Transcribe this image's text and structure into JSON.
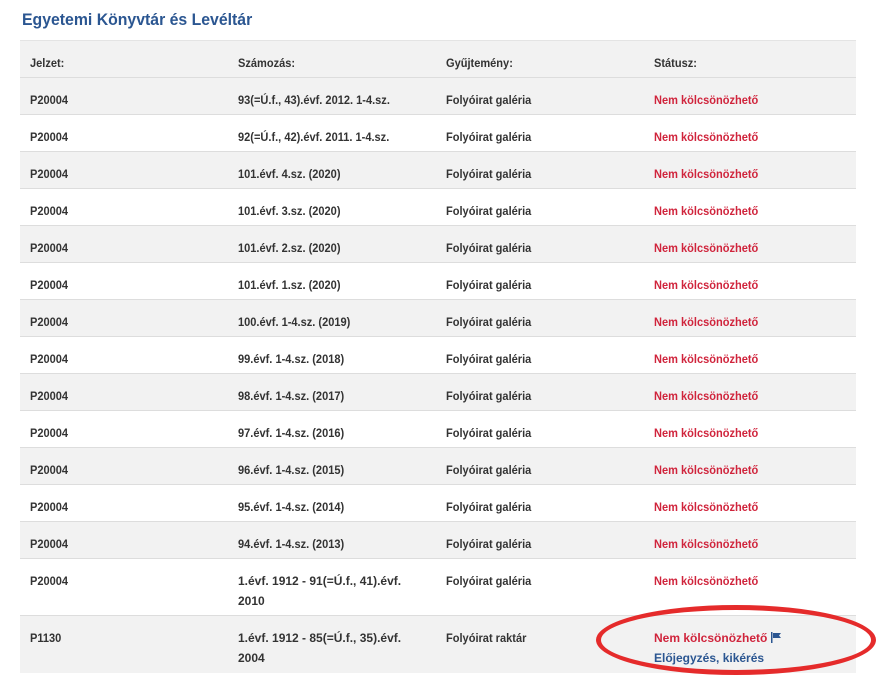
{
  "page": {
    "title": "Egyetemi Könyvtár és Levéltár"
  },
  "table": {
    "headers": [
      "Jelzet:",
      "Számozás:",
      "Gyűjtemény:",
      "Státusz:"
    ],
    "rows": [
      {
        "jelzet": "P20004",
        "szamozas": "93(=Ú.f., 43).évf. 2012. 1-4.sz.",
        "gyujtemeny": "Folyóirat galéria",
        "statusz": "Nem kölcsönözhető"
      },
      {
        "jelzet": "P20004",
        "szamozas": "92(=Ú.f., 42).évf. 2011. 1-4.sz.",
        "gyujtemeny": "Folyóirat galéria",
        "statusz": "Nem kölcsönözhető"
      },
      {
        "jelzet": "P20004",
        "szamozas": "101.évf. 4.sz. (2020)",
        "gyujtemeny": "Folyóirat galéria",
        "statusz": "Nem kölcsönözhető"
      },
      {
        "jelzet": "P20004",
        "szamozas": "101.évf. 3.sz. (2020)",
        "gyujtemeny": "Folyóirat galéria",
        "statusz": "Nem kölcsönözhető"
      },
      {
        "jelzet": "P20004",
        "szamozas": "101.évf. 2.sz. (2020)",
        "gyujtemeny": "Folyóirat galéria",
        "statusz": "Nem kölcsönözhető"
      },
      {
        "jelzet": "P20004",
        "szamozas": "101.évf. 1.sz. (2020)",
        "gyujtemeny": "Folyóirat galéria",
        "statusz": "Nem kölcsönözhető"
      },
      {
        "jelzet": "P20004",
        "szamozas": "100.évf. 1-4.sz. (2019)",
        "gyujtemeny": "Folyóirat galéria",
        "statusz": "Nem kölcsönözhető"
      },
      {
        "jelzet": "P20004",
        "szamozas": "99.évf. 1-4.sz. (2018)",
        "gyujtemeny": "Folyóirat galéria",
        "statusz": "Nem kölcsönözhető"
      },
      {
        "jelzet": "P20004",
        "szamozas": "98.évf. 1-4.sz. (2017)",
        "gyujtemeny": "Folyóirat galéria",
        "statusz": "Nem kölcsönözhető"
      },
      {
        "jelzet": "P20004",
        "szamozas": "97.évf. 1-4.sz. (2016)",
        "gyujtemeny": "Folyóirat galéria",
        "statusz": "Nem kölcsönözhető"
      },
      {
        "jelzet": "P20004",
        "szamozas": "96.évf. 1-4.sz. (2015)",
        "gyujtemeny": "Folyóirat galéria",
        "statusz": "Nem kölcsönözhető"
      },
      {
        "jelzet": "P20004",
        "szamozas": "95.évf. 1-4.sz. (2014)",
        "gyujtemeny": "Folyóirat galéria",
        "statusz": "Nem kölcsönözhető"
      },
      {
        "jelzet": "P20004",
        "szamozas": "94.évf. 1-4.sz. (2013)",
        "gyujtemeny": "Folyóirat galéria",
        "statusz": "Nem kölcsönözhető"
      },
      {
        "jelzet": "P20004",
        "szamozas": "1.évf. 1912 - 91(=Ú.f., 41).évf. 2010",
        "gyujtemeny": "Folyóirat galéria",
        "statusz": "Nem kölcsönözhető"
      },
      {
        "jelzet": "P1130",
        "szamozas": "1.évf. 1912 - 85(=Ú.f., 35).évf. 2004",
        "gyujtemeny": "Folyóirat raktár",
        "statusz": "Nem kölcsönözhető",
        "action": "Előjegyzés, kikérés"
      }
    ]
  },
  "colors": {
    "title": "#2b5691",
    "status": "#d0243c",
    "link": "#2b5691",
    "highlight": "#e52b2b",
    "stripe": "#f2f2f2"
  },
  "icons": {
    "action": "flag-icon"
  }
}
